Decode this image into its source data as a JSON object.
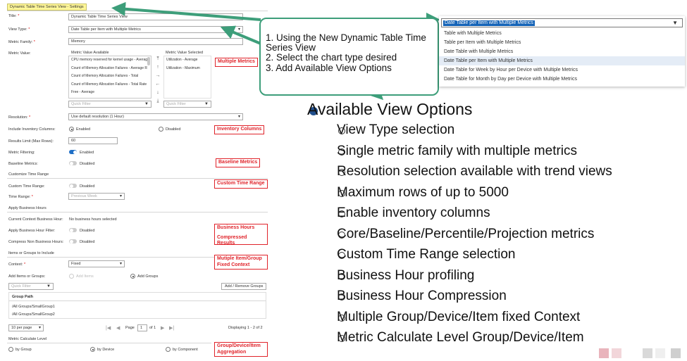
{
  "settings_title": "Dynamic Table Time Series View - Settings",
  "form": {
    "title_label": "Title:",
    "title_value": "Dynamic Table Time Series View",
    "view_type_label": "View Type:",
    "view_type_value": "Date Table per Item with Multiple Metrics",
    "metric_family_label": "Metric Family:",
    "metric_family_value": "Memory",
    "metric_value_label": "Metric Value:",
    "available_header": "Metric Value Available",
    "selected_header": "Metric Value Selected",
    "available_items": [
      "CPU memory reserved for kernel usage - Averag",
      "Count of Memory Allocation Failures - Average R",
      "Count of Memory Allocation Failures - Total",
      "Count of Memory Allocation Failures - Total Rate",
      "Free - Average"
    ],
    "selected_items": [
      "Utilization - Average",
      "Utilization - Maximum"
    ],
    "quick_filter": "Quick Filter",
    "resolution_label": "Resolution:",
    "resolution_value": "Use default resolution (1 Hour)",
    "inventory_label": "Include Inventory Columns:",
    "enabled": "Enabled",
    "disabled": "Disabled",
    "results_limit_label": "Results Limit (Max Rows):",
    "results_limit_value": "60",
    "metric_filtering_label": "Metric Filtering:",
    "baseline_label": "Baseline Metrics:",
    "customize_section": "Customize Time Range",
    "custom_time_label": "Custom Time Range:",
    "time_range_label": "Time Range:",
    "time_range_value": "Previous Week",
    "business_section": "Apply Business Hours",
    "current_context_label": "Current Context Business Hour:",
    "current_context_value": "No business hours selected",
    "apply_filter_label": "Apply Business Hour Filter:",
    "compress_label": "Compress Non Business Hours:",
    "items_section": "Items or Groups to Include",
    "context_label": "Context:",
    "context_value": "Fixed",
    "add_label": "Add Items or Groups:",
    "add_items": "Add Items",
    "add_groups": "Add Groups",
    "add_remove_btn": "Add / Remove Groups",
    "group_path_header": "Group Path",
    "group_rows": [
      "/All Groups/SmallGroup1",
      "/All Groups/SmallGroup2"
    ],
    "per_page": "10 per page",
    "page_label": "Page",
    "page_value": "1",
    "page_of": "of 1",
    "displaying": "Displaying 1 - 2 of 2",
    "calc_section": "Metric Calculate Level",
    "by_group": "by Group",
    "by_device": "by Device",
    "by_component": "by Component"
  },
  "red_labels": {
    "multiple_metrics": "Multiple Metrics",
    "inventory_columns": "Inventory Columns",
    "baseline_metrics": "Baseline Metrics",
    "custom_time_range": "Custom Time Range",
    "business_hours": "Business Hours",
    "compressed_results": "Compressed Results",
    "multiple_item_l1": "Mutiple Item/Group",
    "multiple_item_l2": "Fixed Context",
    "aggregation_l1": "Group/Device/Item",
    "aggregation_l2": "Aggregation"
  },
  "callout": {
    "line1": "1. Using the New Dynamic Table Time",
    "line2": "Series View",
    "line3": "2. Select the chart type desired",
    "line4": "3. Add Available View Options"
  },
  "dropdown": {
    "selected": "Date Table per Item with Multiple Metrics",
    "options": [
      "Table with Multiple Metrics",
      "Table per Item with Multiple Metrics",
      "Date Table with Multiple Metrics",
      "Date Table per Item with Multiple Metrics",
      "Date Table for Week by Hour per Device with Multiple Metrics",
      "Date Table for Month by Day per Device with Multiple Metrics"
    ]
  },
  "bullets": {
    "main": "Available View Options",
    "items": [
      "View Type selection",
      "Single metric family with multiple metrics",
      "Resolution selection available with trend views",
      "Maximum rows of up to 5000",
      "Enable inventory columns",
      "Core/Baseline/Percentile/Projection metrics",
      "Custom Time Range selection",
      "Business Hour profiling",
      "Business Hour Compression",
      "Multiple Group/Device/Item fixed Context",
      "Metric Calculate Level Group/Device/Item"
    ]
  },
  "colors": {
    "callout_border": "#3d9e7a",
    "red_label": "#e0232a",
    "bullet_dot": "#1f4e8c",
    "select_highlight": "#1463b7"
  }
}
